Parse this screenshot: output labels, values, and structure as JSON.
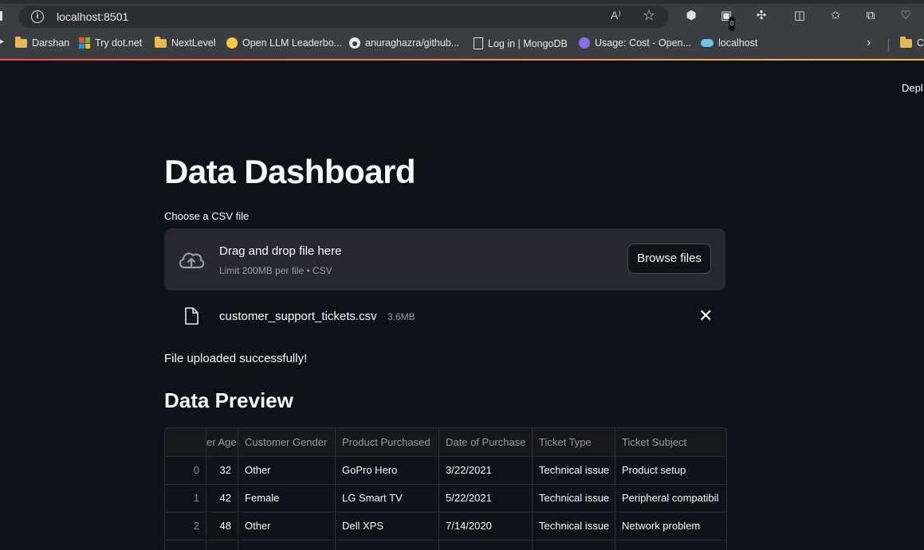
{
  "browser": {
    "url": "localhost:8501",
    "aa_label": "A⁾",
    "bookmarks": [
      {
        "label": "Darshan",
        "icon": "folder-icon"
      },
      {
        "label": "Try dot.net",
        "icon": "microsoft-icon"
      },
      {
        "label": "NextLevel",
        "icon": "folder-icon"
      },
      {
        "label": "Open LLM Leaderbo...",
        "icon": "huggingface-icon"
      },
      {
        "label": "anuraghazra/github...",
        "icon": "github-icon"
      },
      {
        "label": "Log in | MongoDB",
        "icon": "page-icon"
      },
      {
        "label": "Usage: Cost - Open...",
        "icon": "openai-icon"
      },
      {
        "label": "localhost",
        "icon": "localhost-icon"
      }
    ],
    "extension_badge": "0"
  },
  "app": {
    "deploy_label": "Depl",
    "title": "Data Dashboard",
    "uploader": {
      "label": "Choose a CSV file",
      "drag_text": "Drag and drop file here",
      "limit_text": "Limit 200MB per file • CSV",
      "browse_label": "Browse files"
    },
    "uploaded_file": {
      "name": "customer_support_tickets.csv",
      "size": "3.6MB"
    },
    "success_message": "File uploaded successfully!",
    "preview_heading": "Data Preview",
    "table": {
      "columns": [
        "er Age",
        "Customer Gender",
        "Product Purchased",
        "Date of Purchase",
        "Ticket Type",
        "Ticket Subject"
      ],
      "rows": [
        {
          "index": "0",
          "cells": [
            "32",
            "Other",
            "GoPro Hero",
            "3/22/2021",
            "Technical issue",
            "Product setup"
          ]
        },
        {
          "index": "1",
          "cells": [
            "42",
            "Female",
            "LG Smart TV",
            "5/22/2021",
            "Technical issue",
            "Peripheral compatibil"
          ]
        },
        {
          "index": "2",
          "cells": [
            "48",
            "Other",
            "Dell XPS",
            "7/14/2020",
            "Technical issue",
            "Network problem"
          ]
        }
      ]
    }
  }
}
